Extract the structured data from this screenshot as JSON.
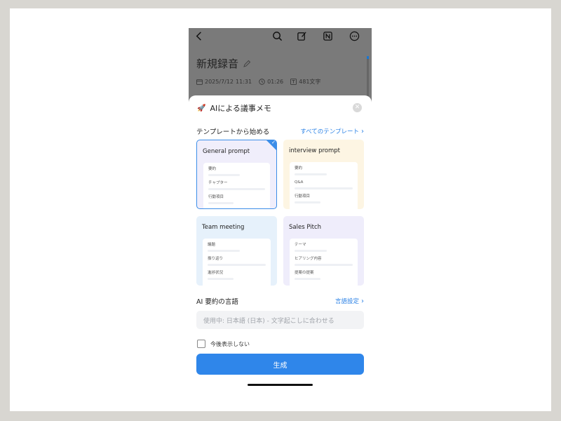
{
  "bg_screen": {
    "title": "新規録音",
    "date": "2025/7/12",
    "time": "11:31",
    "duration": "01:26",
    "char_count": "481文字"
  },
  "sheet": {
    "title": "AIによる議事メモ",
    "template_section_label": "テンプレートから始める",
    "all_templates_link": "すべてのテンプレート",
    "templates": [
      {
        "title": "General prompt",
        "items": [
          "要約",
          "チャプター",
          "行動項目"
        ],
        "bg": "#f0eefb",
        "selected": true
      },
      {
        "title": "interview prompt",
        "items": [
          "要約",
          "Q&A",
          "行動項目"
        ],
        "bg": "#fdf5e3",
        "selected": false
      },
      {
        "title": "Team meeting",
        "items": [
          "議題",
          "振り返り",
          "進捗状況"
        ],
        "bg": "#e6f1fb",
        "selected": false
      },
      {
        "title": "Sales Pitch",
        "items": [
          "テーマ",
          "ヒアリング内容",
          "提案の提案"
        ],
        "bg": "#efedfb",
        "selected": false
      }
    ],
    "language_section_label": "AI 要約の言語",
    "language_settings_link": "言語設定",
    "language_value": "使用中: 日本語 (日本) - 文字起こしに合わせる",
    "dont_show_label": "今後表示しない",
    "generate_label": "生成"
  },
  "colors": {
    "accent": "#2f86ea",
    "dim_overlay": "#7a7a7a"
  }
}
